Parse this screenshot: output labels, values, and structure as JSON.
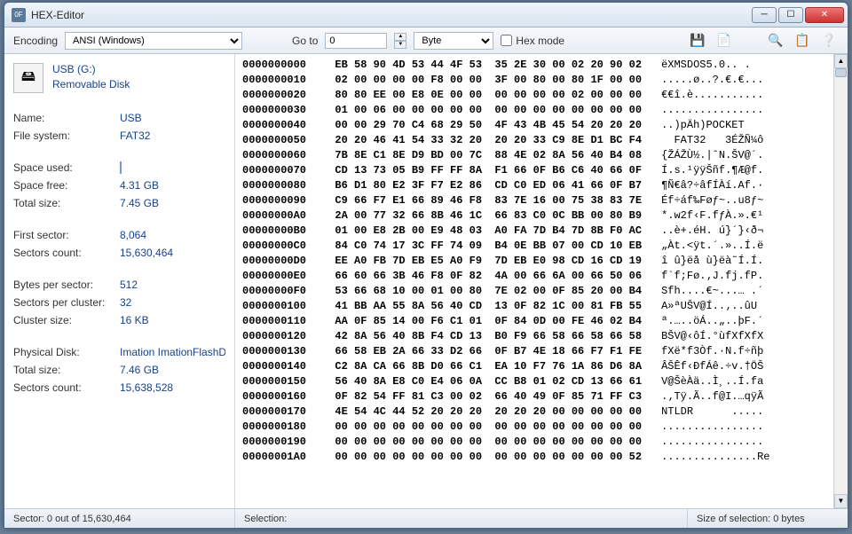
{
  "title": "HEX-Editor",
  "toolbar": {
    "encoding_label": "Encoding",
    "encoding_value": "ANSI (Windows)",
    "goto_label": "Go to",
    "goto_value": "0",
    "type_value": "Byte",
    "hexmode_label": "Hex mode"
  },
  "sidebar": {
    "drive_name": "USB (G:)",
    "drive_type": "Removable Disk",
    "name_label": "Name:",
    "name_value": "USB",
    "fs_label": "File system:",
    "fs_value": "FAT32",
    "space_used_label": "Space used:",
    "space_free_label": "Space free:",
    "space_free_value": "4.31 GB",
    "total_size_label": "Total size:",
    "total_size_value": "7.45 GB",
    "first_sector_label": "First sector:",
    "first_sector_value": "8,064",
    "sectors_count_label": "Sectors count:",
    "sectors_count_value": "15,630,464",
    "bps_label": "Bytes per sector:",
    "bps_value": "512",
    "spc_label": "Sectors per cluster:",
    "spc_value": "32",
    "cluster_label": "Cluster size:",
    "cluster_value": "16 KB",
    "phys_label": "Physical Disk:",
    "phys_value": "Imation ImationFlashDr",
    "phys_total_label": "Total size:",
    "phys_total_value": "7.46 GB",
    "phys_sectors_label": "Sectors count:",
    "phys_sectors_value": "15,638,528"
  },
  "hex": {
    "rows": [
      {
        "off": "0000000000",
        "b": "EB 58 90 4D 53 44 4F 53  35 2E 30 00 02 20 90 02",
        "a": "ëXMSDOS5.0.. ."
      },
      {
        "off": "0000000010",
        "b": "02 00 00 00 00 F8 00 00  3F 00 80 00 80 1F 00 00",
        "a": ".....ø..?.€.€..."
      },
      {
        "off": "0000000020",
        "b": "80 80 EE 00 E8 0E 00 00  00 00 00 00 02 00 00 00",
        "a": "€€î.è..........."
      },
      {
        "off": "0000000030",
        "b": "01 00 06 00 00 00 00 00  00 00 00 00 00 00 00 00",
        "a": "................"
      },
      {
        "off": "0000000040",
        "b": "00 00 29 70 C4 68 29 50  4F 43 4B 45 54 20 20 20",
        "a": "..)pÄh)POCKET   "
      },
      {
        "off": "0000000050",
        "b": "20 20 46 41 54 33 32 20  20 20 33 C9 8E D1 BC F4",
        "a": "  FAT32   3ÉŽÑ¼ô"
      },
      {
        "off": "0000000060",
        "b": "7B 8E C1 8E D9 BD 00 7C  88 4E 02 8A 56 40 B4 08",
        "a": "{ŽÁŽÙ½.|ˆN.ŠV@´."
      },
      {
        "off": "0000000070",
        "b": "CD 13 73 05 B9 FF FF 8A  F1 66 0F B6 C6 40 66 0F",
        "a": "Í.s.¹ÿÿŠñf.¶Æ@f."
      },
      {
        "off": "0000000080",
        "b": "B6 D1 80 E2 3F F7 E2 86  CD C0 ED 06 41 66 0F B7",
        "a": "¶Ñ€â?÷âfÍÀí.Af.·"
      },
      {
        "off": "0000000090",
        "b": "C9 66 F7 E1 66 89 46 F8  83 7E 16 00 75 38 83 7E",
        "a": "Éf÷áf‰Føƒ~..u8ƒ~"
      },
      {
        "off": "00000000A0",
        "b": "2A 00 77 32 66 8B 46 1C  66 83 C0 0C BB 00 80 B9",
        "a": "*.w2f‹F.fƒÀ.».€¹"
      },
      {
        "off": "00000000B0",
        "b": "01 00 E8 2B 00 E9 48 03  A0 FA 7D B4 7D 8B F0 AC",
        "a": "..è+.éH. ú}´}‹ð¬"
      },
      {
        "off": "00000000C0",
        "b": "84 C0 74 17 3C FF 74 09  B4 0E BB 07 00 CD 10 EB",
        "a": "„Àt.<ÿt.´.»..Í.ë"
      },
      {
        "off": "00000000D0",
        "b": "EE A0 FB 7D EB E5 A0 F9  7D EB E0 98 CD 16 CD 19",
        "a": "î û}ëå ù}ëà˜Í.Í."
      },
      {
        "off": "00000000E0",
        "b": "66 60 66 3B 46 F8 0F 82  4A 00 66 6A 00 66 50 06",
        "a": "f`f;Fø.‚J.fj.fP."
      },
      {
        "off": "00000000F0",
        "b": "53 66 68 10 00 01 00 80  7E 02 00 0F 85 20 00 B4",
        "a": "Sfh....€~...… .´"
      },
      {
        "off": "0000000100",
        "b": "41 BB AA 55 8A 56 40 CD  13 0F 82 1C 00 81 FB 55",
        "a": "A»ªUŠV@Í..‚..ûU"
      },
      {
        "off": "0000000110",
        "b": "AA 0F 85 14 00 F6 C1 01  0F 84 0D 00 FE 46 02 B4",
        "a": "ª.…..öÁ..„..þF.´"
      },
      {
        "off": "0000000120",
        "b": "42 8A 56 40 8B F4 CD 13  B0 F9 66 58 66 58 66 58",
        "a": "BŠV@‹ôÍ.°ùfXfXfX"
      },
      {
        "off": "0000000130",
        "b": "66 58 EB 2A 66 33 D2 66  0F B7 4E 18 66 F7 F1 FE",
        "a": "fXë*f3Òf.·N.f÷ñþ"
      },
      {
        "off": "0000000140",
        "b": "C2 8A CA 66 8B D0 66 C1  EA 10 F7 76 1A 86 D6 8A",
        "a": "ÂŠÊf‹ÐfÁê.÷v.†ÖŠ"
      },
      {
        "off": "0000000150",
        "b": "56 40 8A E8 C0 E4 06 0A  CC B8 01 02 CD 13 66 61",
        "a": "V@ŠèÀä..Ì¸..Í.fa"
      },
      {
        "off": "0000000160",
        "b": "0F 82 54 FF 81 C3 00 02  66 40 49 0F 85 71 FF C3",
        "a": ".‚Tÿ.Ã..f@I.…qÿÃ"
      },
      {
        "off": "0000000170",
        "b": "4E 54 4C 44 52 20 20 20  20 20 20 00 00 00 00 00",
        "a": "NTLDR      ....."
      },
      {
        "off": "0000000180",
        "b": "00 00 00 00 00 00 00 00  00 00 00 00 00 00 00 00",
        "a": "................"
      },
      {
        "off": "0000000190",
        "b": "00 00 00 00 00 00 00 00  00 00 00 00 00 00 00 00",
        "a": "................"
      },
      {
        "off": "00000001A0",
        "b": "00 00 00 00 00 00 00 00  00 00 00 00 00 00 00 52",
        "a": "...............Re"
      }
    ]
  },
  "status": {
    "sector_label": "Sector:",
    "sector_value": "0 out of 15,630,464",
    "selection_label": "Selection:",
    "size_label": "Size of selection:",
    "size_value": "0 bytes"
  }
}
